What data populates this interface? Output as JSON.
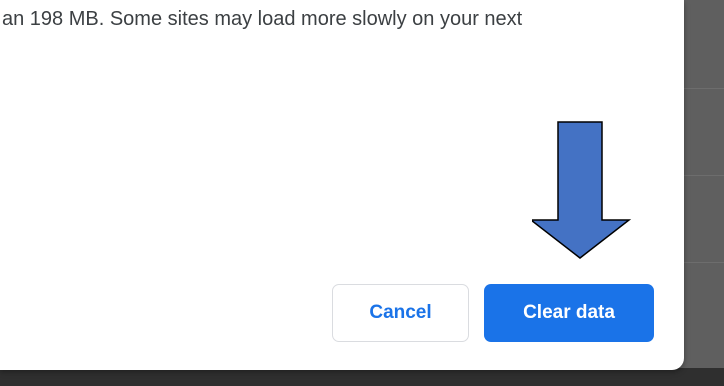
{
  "dialog": {
    "message_fragment": "an 198 MB. Some sites may load more slowly on your next",
    "cancel_label": "Cancel",
    "confirm_label": "Clear data"
  },
  "colors": {
    "primary_blue": "#1a73e8",
    "annotation_arrow": "#4472c4",
    "text": "#3c4043"
  },
  "annotation": {
    "icon": "down-arrow-icon"
  }
}
